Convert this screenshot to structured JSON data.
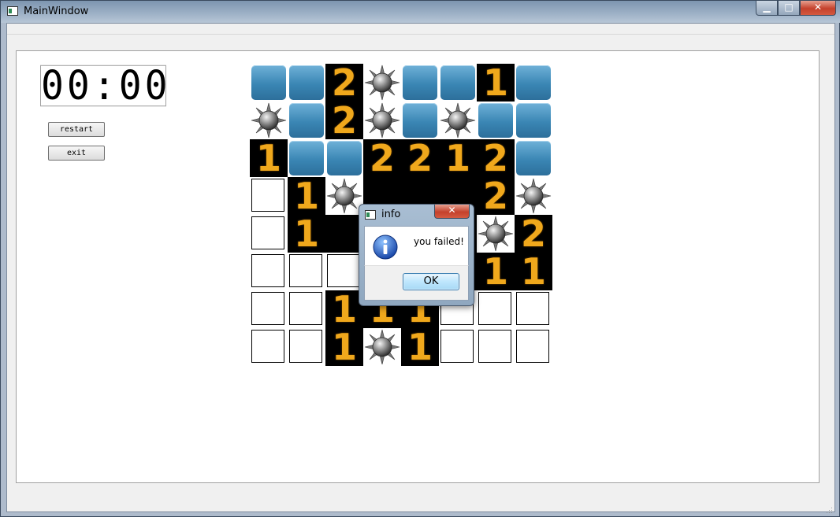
{
  "window": {
    "title": "MainWindow",
    "minimize": "▁",
    "maximize": "□",
    "close": "✕"
  },
  "timer": "00:00",
  "buttons": {
    "restart": "restart",
    "exit": "exit"
  },
  "board": {
    "rows": [
      [
        "H",
        "H",
        "2",
        "M",
        "H",
        "H",
        "1",
        "H"
      ],
      [
        "M",
        "H",
        "2",
        "M",
        "H",
        "M",
        "H",
        "H"
      ],
      [
        "1",
        "H",
        "H",
        "2",
        "2",
        "1",
        "2",
        "H"
      ],
      [
        "E",
        "1",
        "M",
        "",
        "",
        "",
        "2",
        "M"
      ],
      [
        "E",
        "1",
        "",
        "",
        "",
        "",
        "M",
        "2"
      ],
      [
        "E",
        "E",
        "E",
        "E",
        "E",
        "1",
        "1",
        "1"
      ],
      [
        "E",
        "E",
        "1",
        "1",
        "1",
        "E",
        "E",
        "E"
      ],
      [
        "E",
        "E",
        "1",
        "M",
        "1",
        "E",
        "E",
        "E"
      ]
    ],
    "legend": {
      "H": "covered",
      "E": "empty",
      "M": "mine",
      "digit": "number"
    }
  },
  "dialog": {
    "title": "info",
    "close": "✕",
    "message": "you failed!",
    "ok": "OK",
    "icon": "info-icon"
  },
  "colors": {
    "covered": "#3a86b4",
    "number": "#f0a81c",
    "titlebar": "#9fb2c7"
  }
}
